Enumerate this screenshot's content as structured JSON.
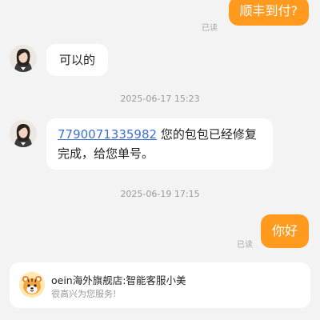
{
  "messages": {
    "m1": {
      "text": "顺丰到付?",
      "status": "已读"
    },
    "m2": {
      "text": "可以的"
    },
    "ts1": "2025-06-17 15:23",
    "m3": {
      "tracking": "7790071335982",
      "text_part1": " 您的包包已经修复",
      "text_part2": "完成，给您单号。"
    },
    "ts2": "2025-06-19 17:15",
    "m4": {
      "text": "你好",
      "status": "已读"
    }
  },
  "service": {
    "name": "oein海外旗舰店:智能客服小美",
    "greeting": "很高兴为您服务!"
  },
  "colors": {
    "background": "#f3f3f3",
    "outgoing_bubble": "#ff9a1f",
    "incoming_bubble": "#ffffff",
    "link": "#3b6fd1"
  }
}
